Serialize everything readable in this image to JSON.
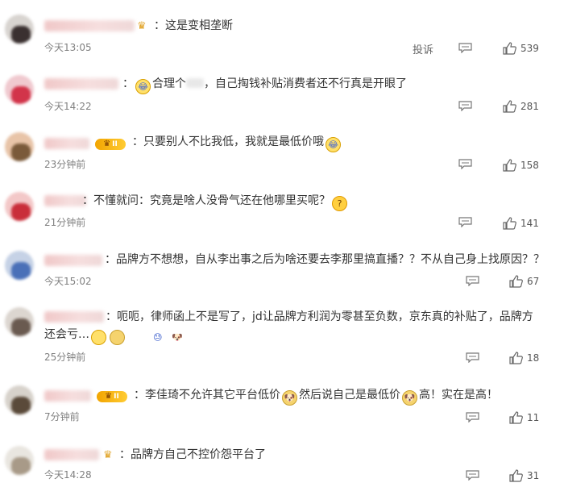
{
  "comments": [
    {
      "text": "：这是变相垄断",
      "time": "今天13:05",
      "likes": "539",
      "report_label": "投诉"
    },
    {
      "text_prefix": "：",
      "text_a": "合理个",
      "text_b": "，自己掏钱补贴消费者还不行真是开眼了",
      "time": "今天14:22",
      "likes": "281"
    },
    {
      "text": "：只要别人不比我低，我就是最低价哦",
      "time": "23分钟前",
      "likes": "158"
    },
    {
      "text": "：不懂就问：究竟是啥人没骨气还在他哪里买呢？",
      "time": "21分钟前",
      "likes": "141"
    },
    {
      "text": "：品牌方不想想，自从李出事之后为啥还要去李那里搞直播？？不从自己身上找原因？？",
      "time": "今天15:02",
      "likes": "67"
    },
    {
      "text": "：呃呃，律师函上不是写了，jd让品牌方利润为零甚至负数，京东真的补贴了，品牌方还会亏…",
      "time": "25分钟前",
      "likes": "18"
    },
    {
      "text_a": "：李佳琦不允许其它平台低价",
      "text_b": "然后说自己是最低价",
      "text_c": "高！实在是高！",
      "time": "7分钟前",
      "likes": "11"
    },
    {
      "text": "：品牌方自己不控价怨平台了",
      "time": "今天14:28",
      "likes": "31"
    }
  ],
  "badges": {
    "vip_label": "II"
  },
  "icons": {
    "reply": "comment-icon",
    "like": "thumb-up-icon",
    "crown": "crown-icon"
  },
  "colors": {
    "text": "#333333",
    "meta": "#808080",
    "vip": "#f2a400"
  }
}
